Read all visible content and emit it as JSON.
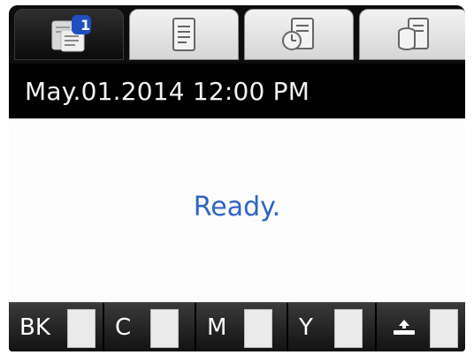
{
  "tabs": [
    {
      "name": "copy-tab",
      "icon": "copy-icon",
      "badge": "1",
      "active": true
    },
    {
      "name": "documents-tab",
      "icon": "document-icon",
      "active": false
    },
    {
      "name": "scheduled-tab",
      "icon": "clock-document-icon",
      "active": false
    },
    {
      "name": "storage-tab",
      "icon": "storage-document-icon",
      "active": false
    }
  ],
  "datetime": "May.01.2014 12:00 PM",
  "status": "Ready.",
  "inks": [
    {
      "label": "BK",
      "level": 1.0
    },
    {
      "label": "C",
      "level": 1.0
    },
    {
      "label": "M",
      "level": 1.0
    },
    {
      "label": "Y",
      "level": 1.0
    },
    {
      "label": "",
      "icon": "maintenance-box-icon",
      "level": 1.0
    }
  ],
  "colors": {
    "status_text": "#2e64c4",
    "background": "#000000"
  }
}
